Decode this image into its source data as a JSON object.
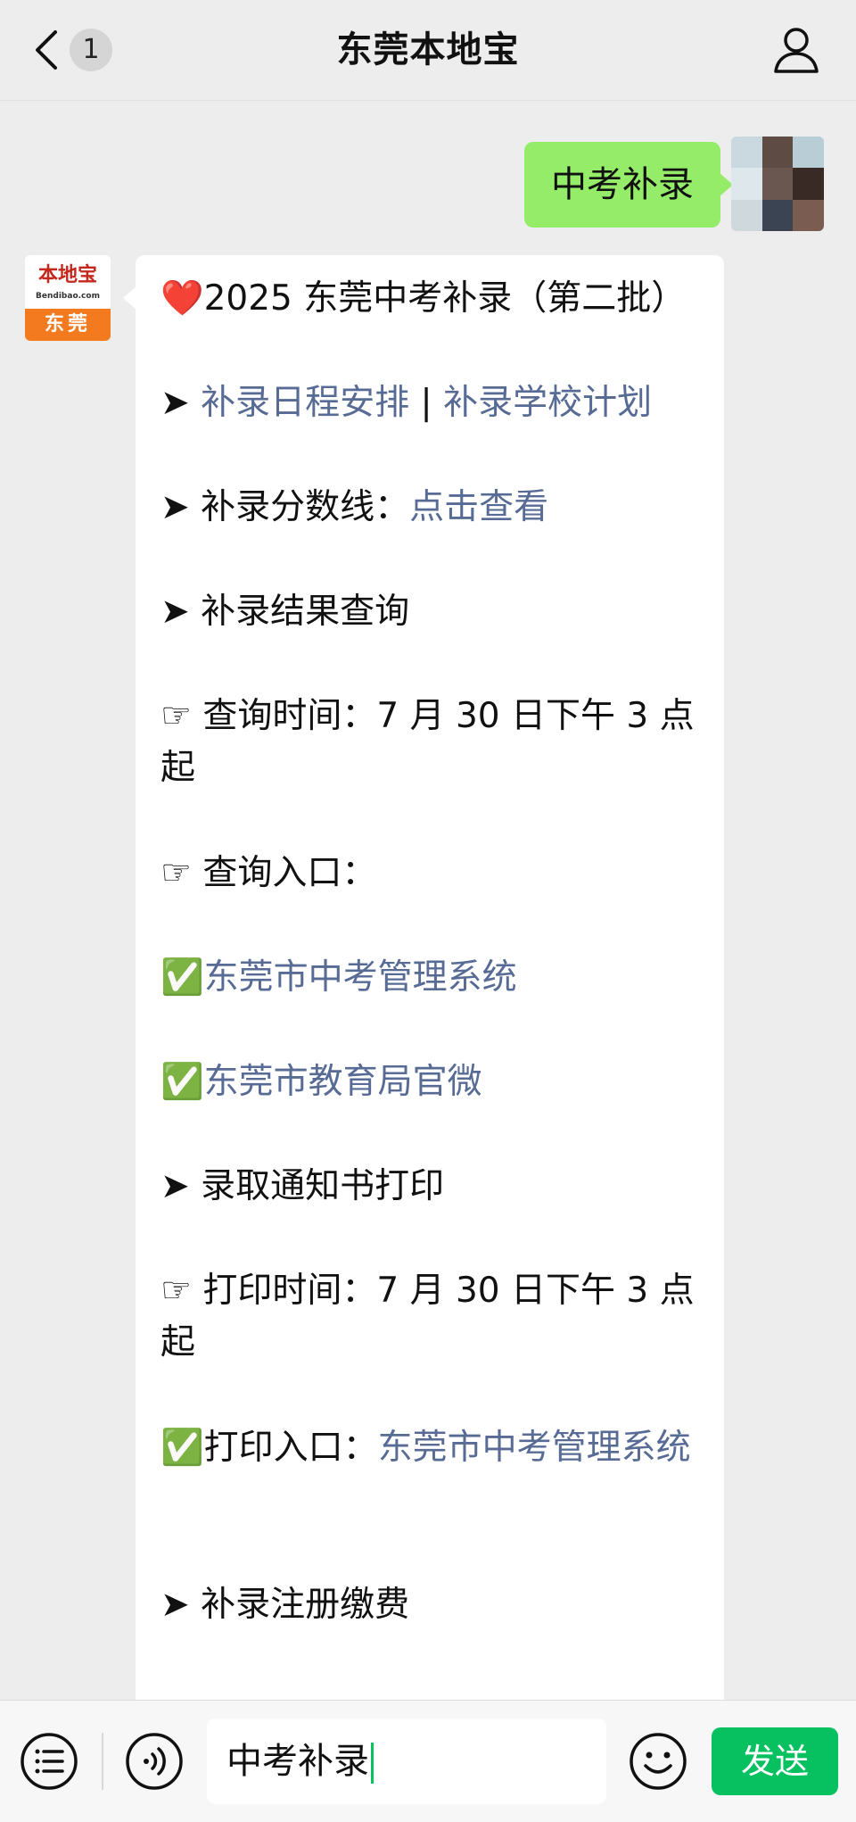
{
  "header": {
    "title": "东莞本地宝",
    "unread_count": "1",
    "back_icon": "chevron-left-icon",
    "profile_icon": "user-icon"
  },
  "chat": {
    "sent_message": "中考补录",
    "bot_avatar": {
      "name": "本地宝",
      "site": "Bendibao.com",
      "city": "东莞"
    },
    "reply": {
      "title_emoji": "❤️",
      "title": "2025 东莞中考补录（第二批）",
      "l1_marker": "➤",
      "l1_link1": "补录日程安排",
      "l1_sep": "|",
      "l1_link2": "补录学校计划",
      "l2_marker": "➤",
      "l2_label": "补录分数线：",
      "l2_link": "点击查看",
      "l3_marker": "➤",
      "l3_text": "补录结果查询",
      "l4_marker": "☞",
      "l4_text": "查询时间：7 月 30 日下午 3 点起",
      "l5_marker": "☞",
      "l5_text": "查询入口：",
      "l6_marker": "✅",
      "l6_link": "东莞市中考管理系统",
      "l7_marker": "✅",
      "l7_link": "东莞市教育局官微",
      "l8_marker": "➤",
      "l8_text": "录取通知书打印",
      "l9_marker": "☞",
      "l9_text": "打印时间：7 月 30 日下午 3 点起",
      "l10_marker": "✅",
      "l10_label": "打印入口：",
      "l10_link": "东莞市中考管理系统",
      "l11_marker": "➤",
      "l11_text": "补录注册缴费"
    }
  },
  "input_bar": {
    "value": "中考补录",
    "send_label": "发送"
  },
  "colors": {
    "sent_bubble": "#95ec69",
    "link": "#576b95",
    "send_button": "#07c160",
    "background": "#ededed"
  }
}
